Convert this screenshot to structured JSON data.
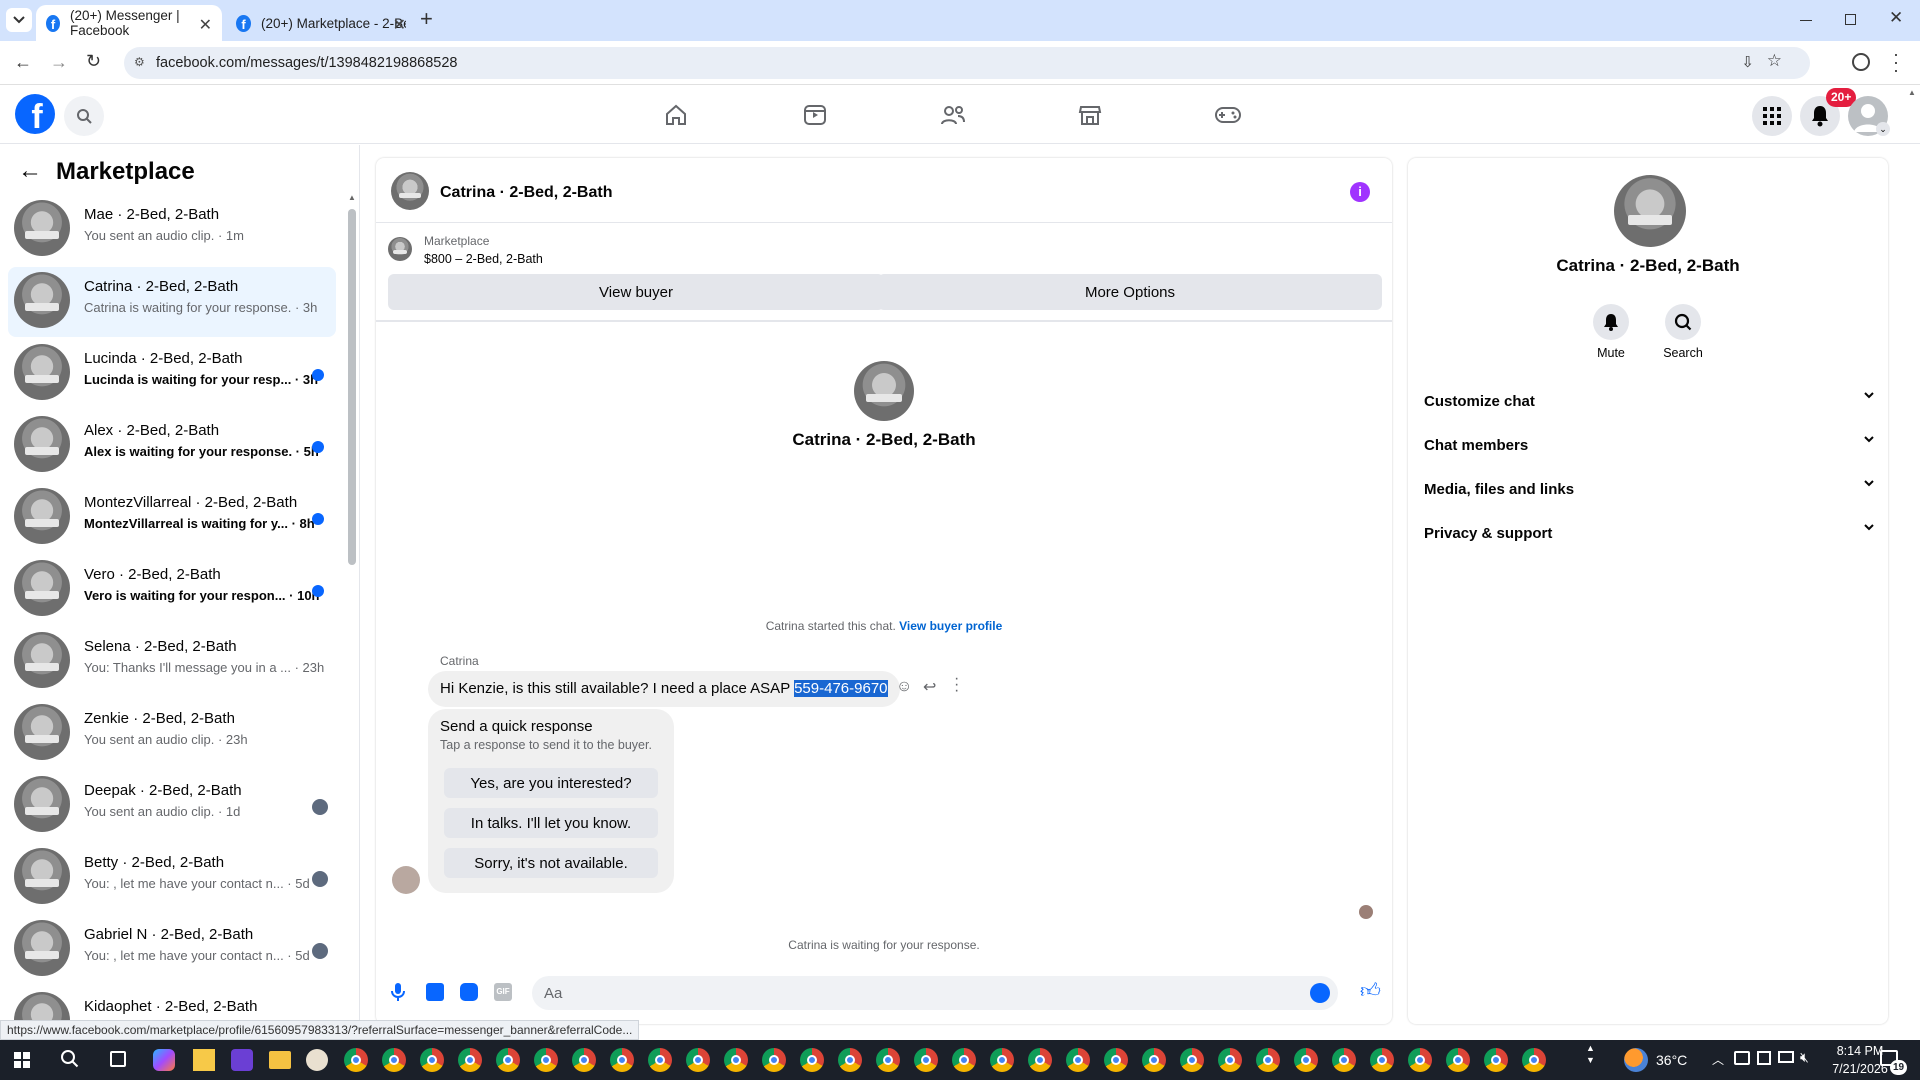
{
  "browser": {
    "tabs": [
      {
        "title": "(20+) Messenger | Facebook"
      },
      {
        "title": "(20+) Marketplace - 2-Bed, 2-B"
      }
    ],
    "url": "facebook.com/messages/t/1398482198868528",
    "status_url": "https://www.facebook.com/marketplace/profile/61560957983313/?referralSurface=messenger_banner&referralCode..."
  },
  "fb": {
    "notif_badge": "20+"
  },
  "left": {
    "title": "Marketplace",
    "conversations": [
      {
        "name": "Mae · 2-Bed, 2-Bath",
        "sub": "You sent an audio clip. · 1m",
        "unread": false
      },
      {
        "name": "Catrina · 2-Bed, 2-Bath",
        "sub": "Catrina is waiting for your response. · 3h",
        "unread": false,
        "selected": true
      },
      {
        "name": "Lucinda · 2-Bed, 2-Bath",
        "sub": "Lucinda is waiting for your resp... · 3h",
        "unread": true
      },
      {
        "name": "Alex · 2-Bed, 2-Bath",
        "sub": "Alex is waiting for your response. · 5h",
        "unread": true
      },
      {
        "name": "MontezVillarreal · 2-Bed, 2-Bath",
        "sub": "MontezVillarreal is waiting for y... · 8h",
        "unread": true
      },
      {
        "name": "Vero · 2-Bed, 2-Bath",
        "sub": "Vero is waiting for your respon... · 10h",
        "unread": true
      },
      {
        "name": "Selena · 2-Bed, 2-Bath",
        "sub": "You: Thanks I'll message you in a ... · 23h",
        "unread": false
      },
      {
        "name": "Zenkie · 2-Bed, 2-Bath",
        "sub": "You sent an audio clip. · 23h",
        "unread": false
      },
      {
        "name": "Deepak · 2-Bed, 2-Bath",
        "sub": "You sent an audio clip. · 1d",
        "unread": false
      },
      {
        "name": "Betty · 2-Bed, 2-Bath",
        "sub": "You: , let me have your contact n... · 5d",
        "unread": false
      },
      {
        "name": "Gabriel N · 2-Bed, 2-Bath",
        "sub": "You: , let me have your contact n... · 5d",
        "unread": false
      },
      {
        "name": "Kidaophet · 2-Bed, 2-Bath",
        "sub": "",
        "unread": false
      }
    ]
  },
  "chat": {
    "header_name": "Catrina · 2-Bed, 2-Bath",
    "listing_label": "Marketplace",
    "listing_price": "$800 – 2-Bed, 2-Bath",
    "view_buyer": "View buyer",
    "more_options": "More Options",
    "intro_name": "Catrina · 2-Bed, 2-Bath",
    "started_text": "Catrina started this chat.",
    "view_profile": "View buyer profile",
    "sender": "Catrina",
    "message_text": "Hi Kenzie, is this still available? I need a place ASAP",
    "message_phone": "559-476-9670",
    "quick_title": "Send a quick response",
    "quick_sub": "Tap a response to send it to the buyer.",
    "quick_responses": [
      "Yes, are you interested?",
      "In talks. I'll let you know.",
      "Sorry, it's not available."
    ],
    "waiting": "Catrina is waiting for your response.",
    "composer_placeholder": "Aa"
  },
  "info": {
    "name": "Catrina · 2-Bed, 2-Bath",
    "mute": "Mute",
    "search": "Search",
    "sections": [
      "Customize chat",
      "Chat members",
      "Media, files and links",
      "Privacy & support"
    ]
  },
  "taskbar": {
    "temp": "36°C",
    "time": "8:14 PM",
    "date": "7/21/2026",
    "notif_count": "19"
  },
  "colors": {
    "fb_blue": "#0866ff",
    "accent_purple": "#a033ff",
    "badge_red": "#e41e3f"
  }
}
